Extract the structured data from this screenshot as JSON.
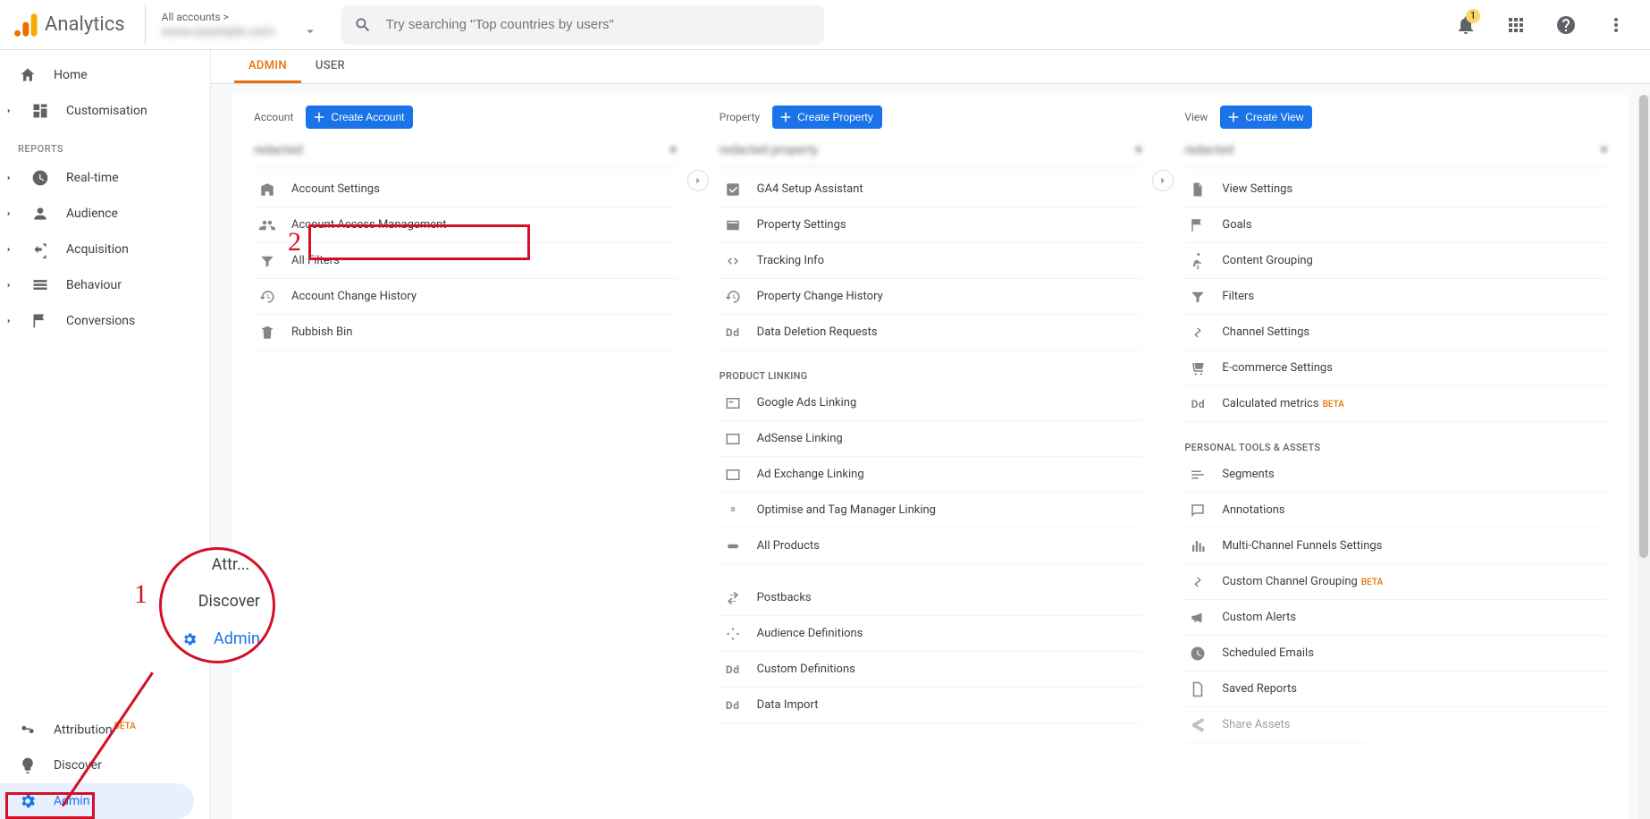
{
  "header": {
    "product_name": "Analytics",
    "breadcrumb": "All accounts >",
    "search_placeholder": "Try searching \"Top countries by users\"",
    "notification_count": "1"
  },
  "left_nav": {
    "home": "Home",
    "customisation": "Customisation",
    "reports_label": "REPORTS",
    "real_time": "Real-time",
    "audience": "Audience",
    "acquisition": "Acquisition",
    "behaviour": "Behaviour",
    "conversions": "Conversions",
    "attribution": "Attribution",
    "attribution_badge": "BETA",
    "discover": "Discover",
    "admin": "Admin"
  },
  "tabs": {
    "admin": "ADMIN",
    "user": "USER"
  },
  "account_col": {
    "label": "Account",
    "create": "Create Account",
    "items": {
      "settings": "Account Settings",
      "access": "Account Access Management",
      "filters": "All Filters",
      "history": "Account Change History",
      "rubbish": "Rubbish Bin"
    }
  },
  "property_col": {
    "label": "Property",
    "create": "Create Property",
    "items": {
      "ga4": "GA4 Setup Assistant",
      "settings": "Property Settings",
      "tracking": "Tracking Info",
      "history": "Property Change History",
      "deletion": "Data Deletion Requests"
    },
    "product_linking_label": "PRODUCT LINKING",
    "linking": {
      "ads": "Google Ads Linking",
      "adsense": "AdSense Linking",
      "adx": "Ad Exchange Linking",
      "optimise": "Optimise and Tag Manager Linking",
      "all": "All Products",
      "postbacks": "Postbacks",
      "audience": "Audience Definitions",
      "custom_def": "Custom Definitions",
      "data_import": "Data Import"
    }
  },
  "view_col": {
    "label": "View",
    "create": "Create View",
    "items": {
      "settings": "View Settings",
      "goals": "Goals",
      "grouping": "Content Grouping",
      "filters": "Filters",
      "channel": "Channel Settings",
      "ecom": "E-commerce Settings",
      "calc": "Calculated metrics",
      "calc_badge": "BETA"
    },
    "personal_label": "PERSONAL TOOLS & ASSETS",
    "personal": {
      "segments": "Segments",
      "annotations": "Annotations",
      "mcf": "Multi-Channel Funnels Settings",
      "custom_channel": "Custom Channel Grouping",
      "custom_channel_badge": "BETA",
      "alerts": "Custom Alerts",
      "emails": "Scheduled Emails",
      "saved": "Saved Reports",
      "share": "Share Assets"
    }
  },
  "callout": {
    "attr_partial": "Attr...",
    "discover": "Discover",
    "admin": "Admin",
    "num1": "1",
    "num2": "2"
  }
}
